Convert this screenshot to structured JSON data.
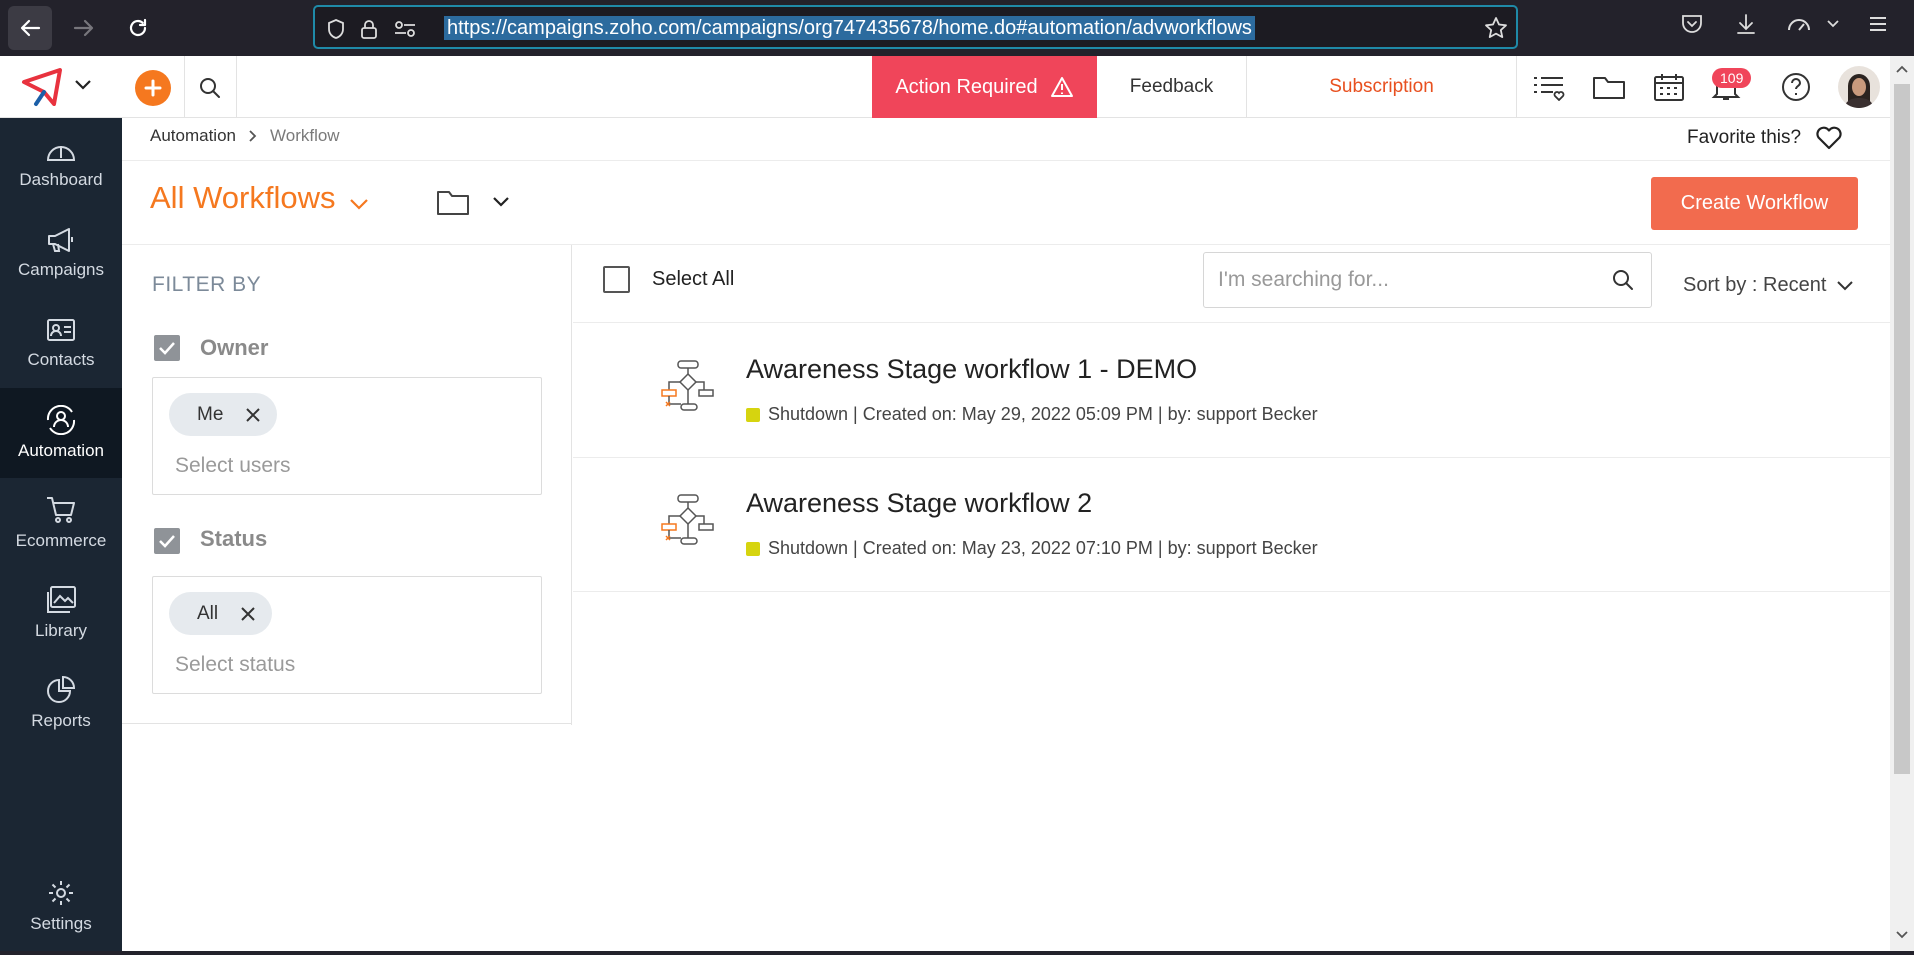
{
  "browser": {
    "url": "https://campaigns.zoho.com/campaigns/org747435678/home.do#automation/advworkflows"
  },
  "sidebar": {
    "items": [
      {
        "label": "Dashboard"
      },
      {
        "label": "Campaigns"
      },
      {
        "label": "Contacts"
      },
      {
        "label": "Automation"
      },
      {
        "label": "Ecommerce"
      },
      {
        "label": "Library"
      },
      {
        "label": "Reports"
      }
    ],
    "settings_label": "Settings"
  },
  "header": {
    "action_required": "Action Required",
    "feedback": "Feedback",
    "subscription": "Subscription",
    "notification_count": "109"
  },
  "breadcrumb": {
    "parent": "Automation",
    "current": "Workflow"
  },
  "favorite_label": "Favorite this?",
  "page": {
    "title": "All Workflows",
    "create_button": "Create Workflow"
  },
  "filters": {
    "heading": "FILTER BY",
    "owner": {
      "label": "Owner",
      "chip": "Me",
      "placeholder": "Select users"
    },
    "status": {
      "label": "Status",
      "chip": "All",
      "placeholder": "Select status"
    }
  },
  "list": {
    "select_all": "Select All",
    "search_placeholder": "I'm searching for...",
    "sort_label": "Sort by : Recent",
    "workflows": [
      {
        "title": "Awareness Stage workflow 1 - DEMO",
        "meta": "Shutdown | Created on: May 29, 2022 05:09 PM | by: support Becker",
        "status_color": "#d6d40f"
      },
      {
        "title": "Awareness Stage workflow 2",
        "meta": "Shutdown | Created on: May 23, 2022 07:10 PM | by: support Becker",
        "status_color": "#d6d40f"
      }
    ]
  },
  "colors": {
    "accent_orange": "#f5781f",
    "action_red": "#f0455a",
    "create_button": "#f26b4e",
    "sidebar_bg": "#1b2633"
  }
}
